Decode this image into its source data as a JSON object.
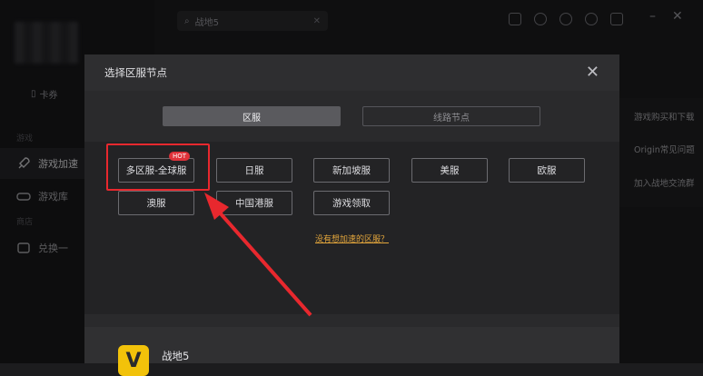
{
  "app": {
    "card_label": "卡券",
    "sidebar_sections": [
      "游戏",
      "商店"
    ],
    "sidebar_items": [
      {
        "label": "游戏加速",
        "icon": "rocket-icon",
        "active": true
      },
      {
        "label": "游戏库",
        "icon": "gamepad-icon",
        "active": false
      },
      {
        "label": "兑换一",
        "icon": "exchange-icon",
        "active": false
      }
    ],
    "search_value": "战地5",
    "right_links": [
      "游戏购买和下载",
      "Origin常见问题",
      "加入战地交流群"
    ]
  },
  "modal": {
    "title": "选择区服节点",
    "tabs": [
      {
        "label": "区服",
        "active": true
      },
      {
        "label": "线路节点",
        "active": false
      }
    ],
    "servers": [
      {
        "label": "多区服-全球服",
        "badge": "HOT",
        "highlighted": true
      },
      {
        "label": "日服"
      },
      {
        "label": "新加坡服"
      },
      {
        "label": "美服"
      },
      {
        "label": "欧服"
      },
      {
        "label": "澳服"
      },
      {
        "label": "中国港服"
      },
      {
        "label": "游戏领取"
      }
    ],
    "help_link": "没有想加速的区服？",
    "game_logo_letter": "V",
    "game_name": "战地5"
  },
  "colors": {
    "highlight": "#e8282e",
    "link": "#e2a53c",
    "game_logo": "#f2c20a"
  }
}
